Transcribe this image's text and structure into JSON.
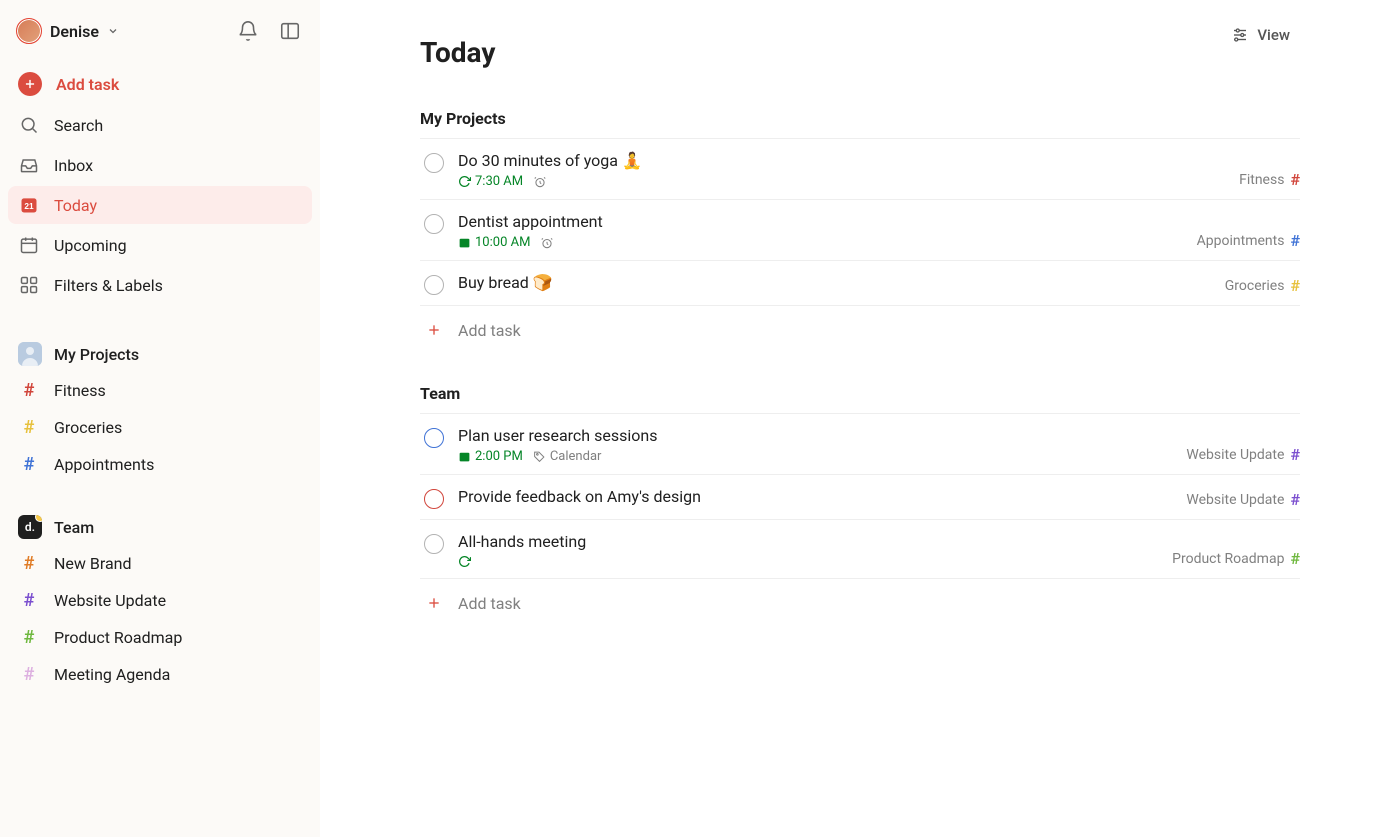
{
  "user": {
    "name": "Denise"
  },
  "sidebar": {
    "add_task": "Add task",
    "nav": [
      {
        "id": "search",
        "label": "Search"
      },
      {
        "id": "inbox",
        "label": "Inbox"
      },
      {
        "id": "today",
        "label": "Today",
        "active": true,
        "badge": "21"
      },
      {
        "id": "upcoming",
        "label": "Upcoming"
      },
      {
        "id": "filters",
        "label": "Filters & Labels"
      }
    ],
    "workspaces": [
      {
        "id": "my-projects",
        "label": "My Projects",
        "projects": [
          {
            "id": "fitness",
            "label": "Fitness",
            "color": "#d1453b"
          },
          {
            "id": "groceries",
            "label": "Groceries",
            "color": "#e7c13c"
          },
          {
            "id": "appointments",
            "label": "Appointments",
            "color": "#4073d6"
          }
        ]
      },
      {
        "id": "team",
        "label": "Team",
        "projects": [
          {
            "id": "new-brand",
            "label": "New Brand",
            "color": "#e07c27"
          },
          {
            "id": "website-update",
            "label": "Website Update",
            "color": "#7b4fcf"
          },
          {
            "id": "product-roadmap",
            "label": "Product Roadmap",
            "color": "#6fb83f"
          },
          {
            "id": "meeting-agenda",
            "label": "Meeting Agenda",
            "color": "#ddb0e0"
          }
        ]
      }
    ]
  },
  "header": {
    "title": "Today",
    "view_label": "View"
  },
  "groups": [
    {
      "id": "my-projects",
      "title": "My Projects",
      "tasks": [
        {
          "title": "Do 30 minutes of yoga 🧘",
          "time": "7:30 AM",
          "recurring": true,
          "reminder": true,
          "priority": "none",
          "project": {
            "label": "Fitness",
            "color": "#d1453b"
          }
        },
        {
          "title": "Dentist appointment",
          "time": "10:00 AM",
          "calendar": true,
          "reminder": true,
          "priority": "none",
          "project": {
            "label": "Appointments",
            "color": "#4073d6"
          }
        },
        {
          "title": "Buy bread 🍞",
          "priority": "none",
          "project": {
            "label": "Groceries",
            "color": "#e7c13c"
          }
        }
      ],
      "add_task": "Add task"
    },
    {
      "id": "team",
      "title": "Team",
      "tasks": [
        {
          "title": "Plan user research sessions",
          "time": "2:00 PM",
          "calendar": true,
          "tag": "Calendar",
          "priority": "blue",
          "project": {
            "label": "Website Update",
            "color": "#7b4fcf"
          }
        },
        {
          "title": "Provide feedback on Amy's design",
          "priority": "red",
          "project": {
            "label": "Website Update",
            "color": "#7b4fcf"
          }
        },
        {
          "title": "All-hands meeting",
          "recurring": true,
          "priority": "none",
          "project": {
            "label": "Product Roadmap",
            "color": "#6fb83f"
          }
        }
      ],
      "add_task": "Add task"
    }
  ]
}
